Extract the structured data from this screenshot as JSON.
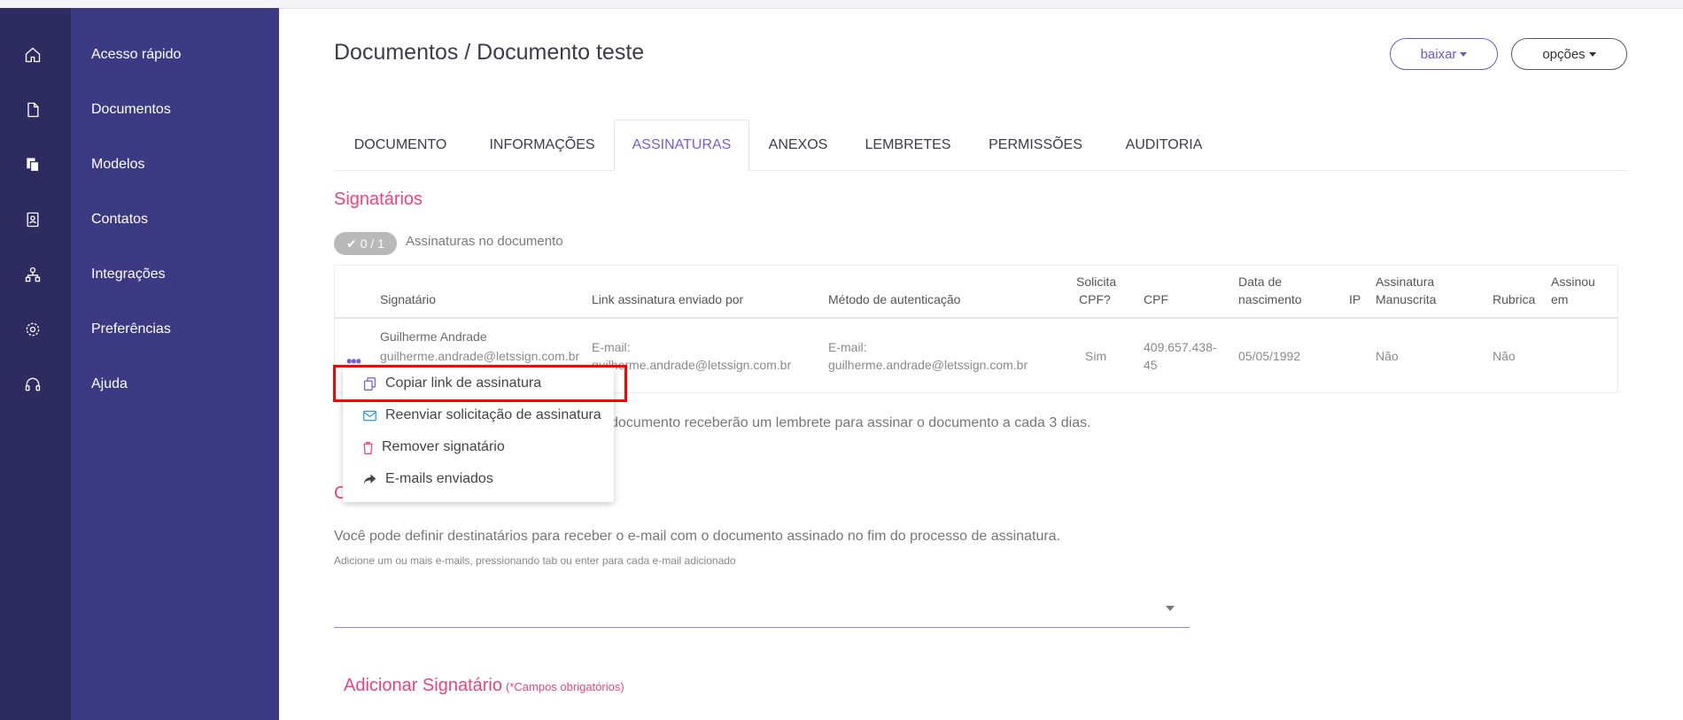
{
  "sidebar": {
    "items": [
      {
        "label": "Acesso rápido",
        "icon": "home-icon"
      },
      {
        "label": "Documentos",
        "icon": "document-icon"
      },
      {
        "label": "Modelos",
        "icon": "templates-icon"
      },
      {
        "label": "Contatos",
        "icon": "contacts-icon"
      },
      {
        "label": "Integrações",
        "icon": "integrations-icon"
      },
      {
        "label": "Preferências",
        "icon": "gear-icon"
      },
      {
        "label": "Ajuda",
        "icon": "headset-icon"
      }
    ]
  },
  "header": {
    "title": "Documentos / Documento teste",
    "download_label": "baixar",
    "options_label": "opções"
  },
  "tabs": [
    {
      "label": "DOCUMENTO"
    },
    {
      "label": "INFORMAÇÕES"
    },
    {
      "label": "ASSINATURAS",
      "active": true
    },
    {
      "label": "ANEXOS"
    },
    {
      "label": "LEMBRETES"
    },
    {
      "label": "PERMISSÕES"
    },
    {
      "label": "AUDITORIA"
    }
  ],
  "signers": {
    "title": "Signatários",
    "badge": "0 / 1",
    "badge_text": "Assinaturas no documento",
    "columns": {
      "signer": "Signatário",
      "link_sent_by": "Link assinatura enviado por",
      "auth_method": "Método de autenticação",
      "requires_cpf_1": "Solicita",
      "requires_cpf_2": "CPF?",
      "cpf": "CPF",
      "birth_1": "Data de",
      "birth_2": "nascimento",
      "ip": "IP",
      "handwritten_1": "Assinatura",
      "handwritten_2": "Manuscrita",
      "initials": "Rubrica",
      "signed_at_1": "Assinou",
      "signed_at_2": "em"
    },
    "row": {
      "name": "Guilherme Andrade",
      "email": "guilherme.andrade@letssign.com.br",
      "link_sent_by_1": "E-mail:",
      "link_sent_by_2": "guilherme.andrade@letssign.com.br",
      "auth_method_1": "E-mail:",
      "auth_method_2": "guilherme.andrade@letssign.com.br",
      "requires_cpf": "Sim",
      "cpf_1": "409.657.438-",
      "cpf_2": "45",
      "birth": "05/05/1992",
      "handwritten": "Não",
      "initials": "Não"
    },
    "reminder_text": "documento receberão um lembrete para assinar o documento a cada 3 dias."
  },
  "context_menu": {
    "items": [
      {
        "label": "Copiar link de assinatura",
        "icon": "copy-icon"
      },
      {
        "label": "Reenviar solicitação de assinatura",
        "icon": "envelope-icon"
      },
      {
        "label": "Remover signatário",
        "icon": "trash-icon"
      },
      {
        "label": "E-mails enviados",
        "icon": "share-arrow-icon"
      }
    ]
  },
  "copy_recipients": {
    "title_fragment": "C",
    "description": "Você pode definir destinatários para receber o e-mail com o documento assinado no fim do processo de assinatura.",
    "hint": "Adicione um ou mais e-mails, pressionando tab ou enter para cada e-mail adicionado"
  },
  "add_signer": {
    "title": "Adicionar Signatário",
    "required_note": "(*Campos obrigatórios)"
  },
  "colors": {
    "sidebar_rail": "#2e2b61",
    "sidebar_panel": "#3b3a82",
    "accent_purple": "#7a5cd3",
    "accent_pink": "#e8457c",
    "highlight_red": "#ff0000"
  }
}
